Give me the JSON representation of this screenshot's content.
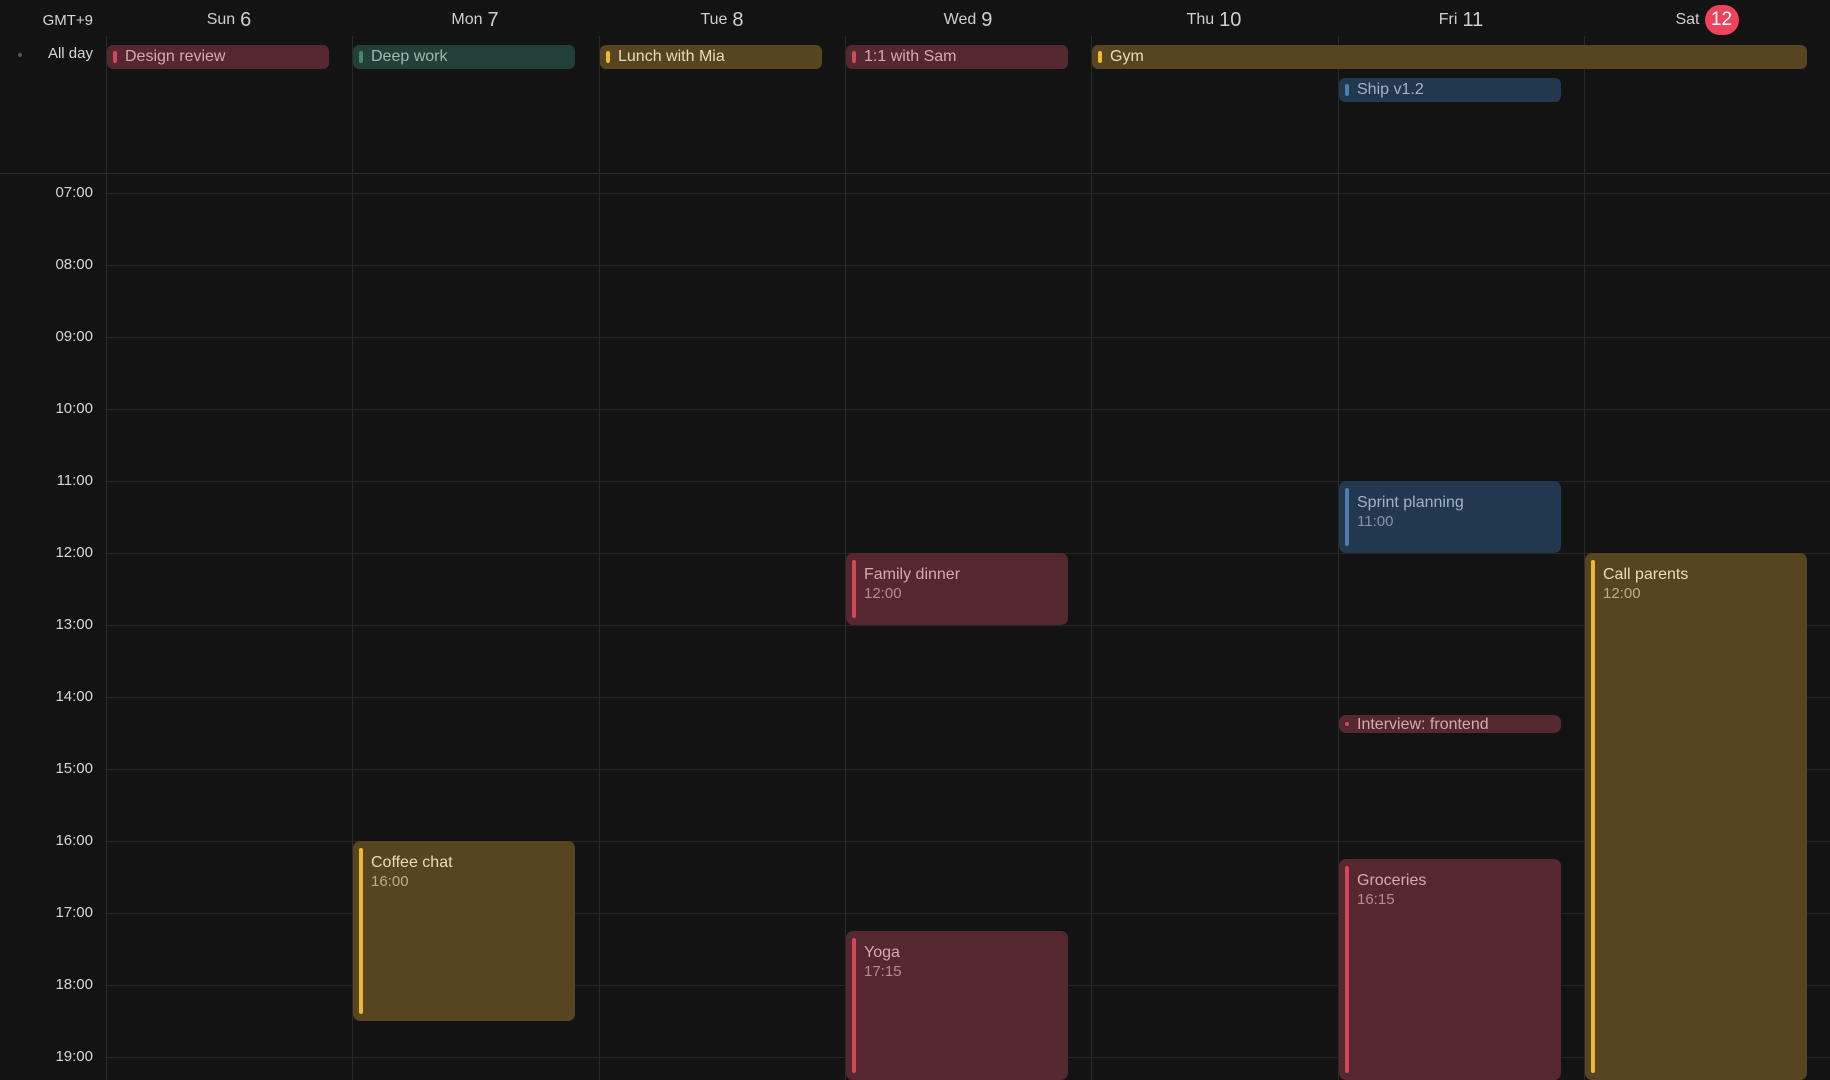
{
  "timezone": "GMT+9",
  "allday_label": "All day",
  "days": [
    {
      "name": "Sun",
      "date": "6"
    },
    {
      "name": "Mon",
      "date": "7"
    },
    {
      "name": "Tue",
      "date": "8"
    },
    {
      "name": "Wed",
      "date": "9"
    },
    {
      "name": "Thu",
      "date": "10"
    },
    {
      "name": "Fri",
      "date": "11"
    },
    {
      "name": "Sat",
      "date": "12",
      "today": true
    }
  ],
  "hours": [
    "07:00",
    "08:00",
    "09:00",
    "10:00",
    "11:00",
    "12:00",
    "13:00",
    "14:00",
    "15:00",
    "16:00",
    "17:00",
    "18:00",
    "19:00"
  ],
  "colors": {
    "red": "#d4485b",
    "green": "#3f8c6c",
    "gold": "#f2b92e",
    "blue": "#4d7db5",
    "today_badge": "#f0425a"
  },
  "allday_events": [
    {
      "title": "Design review",
      "day_start": 0,
      "day_end": 0,
      "row": 0,
      "color": "red"
    },
    {
      "title": "Deep work",
      "day_start": 1,
      "day_end": 1,
      "row": 0,
      "color": "green"
    },
    {
      "title": "Lunch with Mia",
      "day_start": 2,
      "day_end": 2,
      "row": 0,
      "color": "gold"
    },
    {
      "title": "1:1 with Sam",
      "day_start": 3,
      "day_end": 3,
      "row": 0,
      "color": "red"
    },
    {
      "title": "Gym",
      "day_start": 4,
      "day_end": 6,
      "row": 0,
      "color": "gold"
    },
    {
      "title": "Ship v1.2",
      "day_start": 5,
      "day_end": 5,
      "row": 1,
      "color": "blue"
    }
  ],
  "events": [
    {
      "title": "Sprint planning",
      "time": "11:00",
      "day": 5,
      "start": "11:00",
      "end": "12:00",
      "color": "blue"
    },
    {
      "title": "Family dinner",
      "time": "12:00",
      "day": 3,
      "start": "12:00",
      "end": "13:00",
      "color": "red"
    },
    {
      "title": "Call parents",
      "time": "12:00",
      "day": 6,
      "start": "12:00",
      "end": "19:50",
      "color": "gold"
    },
    {
      "title": "Interview: frontend",
      "time": "",
      "day": 5,
      "start": "14:15",
      "end": "14:30",
      "color": "red"
    },
    {
      "title": "Coffee chat",
      "time": "16:00",
      "day": 1,
      "start": "16:00",
      "end": "18:30",
      "color": "gold"
    },
    {
      "title": "Groceries",
      "time": "16:15",
      "day": 5,
      "start": "16:15",
      "end": "19:50",
      "color": "red"
    },
    {
      "title": "Yoga",
      "time": "17:15",
      "day": 3,
      "start": "17:15",
      "end": "19:50",
      "color": "red"
    }
  ]
}
